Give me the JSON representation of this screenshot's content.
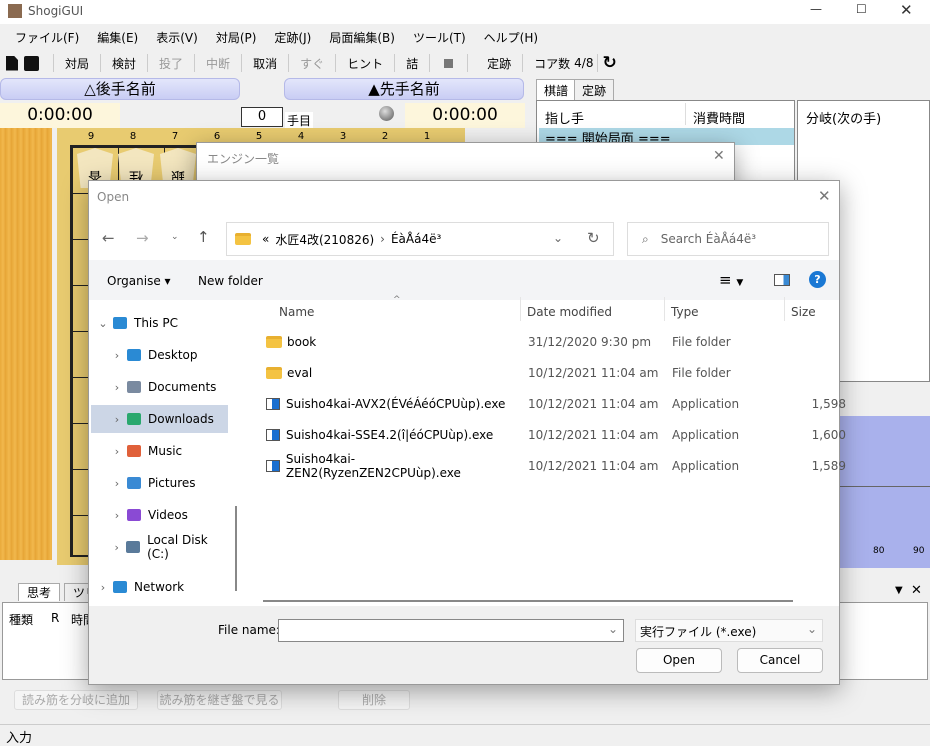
{
  "app": {
    "title": "ShogiGUI"
  },
  "menu": [
    "ファイル(F)",
    "編集(E)",
    "表示(V)",
    "対局(P)",
    "定跡(J)",
    "局面編集(B)",
    "ツール(T)",
    "ヘルプ(H)"
  ],
  "toolbar": {
    "game": "対局",
    "analyze": "検討",
    "resign": "投了",
    "pause": "中断",
    "undo": "取消",
    "now": "すぐ",
    "hint": "ヒント",
    "mate": "詰",
    "book": "定跡",
    "cores_label": "コア数",
    "cores_value": "4/8"
  },
  "players": {
    "gote": "△後手名前",
    "sente": "▲先手名前",
    "gote_time": "0:00:00",
    "sente_time": "0:00:00",
    "move_number": "0",
    "move_suffix": "手目"
  },
  "board": {
    "files": [
      "9",
      "8",
      "7",
      "6",
      "5",
      "4",
      "3",
      "2",
      "1"
    ],
    "top_pieces": [
      "香",
      "桂",
      "銀"
    ]
  },
  "kifu": {
    "tabs": [
      "棋譜",
      "定跡"
    ],
    "col_move": "指し手",
    "col_time": "消費時間",
    "branch_header": "分岐(次の手)",
    "first_row": "=== 開始局面 ==="
  },
  "graph": {
    "ticks": [
      "80",
      "90"
    ],
    "color": "#a9b1ec"
  },
  "think": {
    "tabs": [
      "思考",
      "ツリー"
    ],
    "cols": [
      "種類",
      "R",
      "時間"
    ],
    "add_branch": "読み筋を分岐に追加",
    "view_board": "読み筋を継ぎ盤で見る",
    "delete": "削除"
  },
  "status": {
    "input": "入力"
  },
  "engine_dialog": {
    "title": "エンジン一覧"
  },
  "open_dialog": {
    "title": "Open",
    "path": [
      "«",
      "水匠4改(210826)",
      "ÉàÅá4ë³"
    ],
    "search_placeholder": "Search ÉàÅá4ë³",
    "organise": "Organise",
    "new_folder": "New folder",
    "nav": [
      {
        "label": "This PC",
        "color": "#2a8ad4"
      },
      {
        "label": "Desktop",
        "color": "#2a8ad4"
      },
      {
        "label": "Documents",
        "color": "#7a8aa0"
      },
      {
        "label": "Downloads",
        "color": "#2aa86e"
      },
      {
        "label": "Music",
        "color": "#e0603a"
      },
      {
        "label": "Pictures",
        "color": "#3a8ad4"
      },
      {
        "label": "Videos",
        "color": "#8a4ad4"
      },
      {
        "label": "Local Disk (C:)",
        "color": "#5a7a9a"
      },
      {
        "label": "Network",
        "color": "#2a8ad4"
      }
    ],
    "columns": [
      "Name",
      "Date modified",
      "Type",
      "Size"
    ],
    "files": [
      {
        "name": "book",
        "date": "31/12/2020 9:30 pm",
        "type": "File folder",
        "size": "",
        "kind": "folder"
      },
      {
        "name": "eval",
        "date": "10/12/2021 11:04 am",
        "type": "File folder",
        "size": "",
        "kind": "folder"
      },
      {
        "name": "Suisho4kai-AVX2(ÉVéÁéóCPUùp).exe",
        "date": "10/12/2021 11:04 am",
        "type": "Application",
        "size": "1,598",
        "kind": "exe"
      },
      {
        "name": "Suisho4kai-SSE4.2(î|éóCPUùp).exe",
        "date": "10/12/2021 11:04 am",
        "type": "Application",
        "size": "1,600",
        "kind": "exe"
      },
      {
        "name": "Suisho4kai-ZEN2(RyzenZEN2CPUùp).exe",
        "date": "10/12/2021 11:04 am",
        "type": "Application",
        "size": "1,589",
        "kind": "exe"
      }
    ],
    "file_name_label": "File name:",
    "file_name_value": "",
    "filter": "実行ファイル (*.exe)",
    "open": "Open",
    "cancel": "Cancel"
  }
}
